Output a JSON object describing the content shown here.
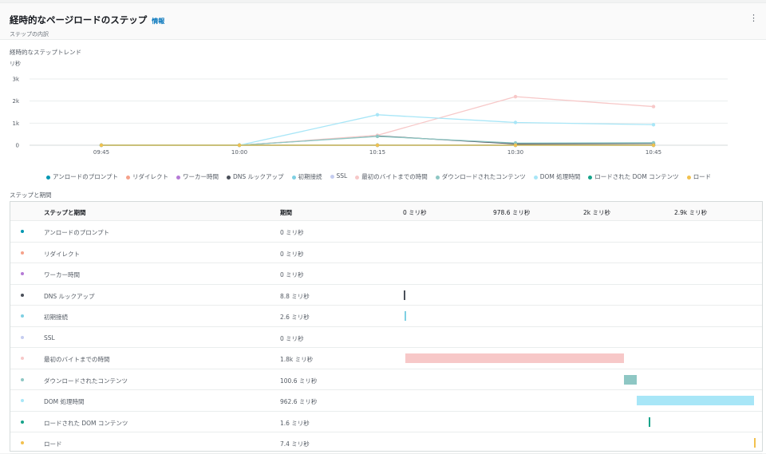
{
  "header": {
    "title": "経時的なページロードのステップ",
    "info": "情報",
    "subtitle": "ステップの内訳",
    "menu": "⋮"
  },
  "chart_section": {
    "title": "経時的なステップトレンド"
  },
  "chart_data": {
    "type": "line",
    "ylabel": "リ秒",
    "ylim": [
      0,
      3000
    ],
    "grid": true,
    "legend": "bottom",
    "yticks": [
      "0",
      "1k",
      "2k",
      "3k"
    ],
    "ytick_values": [
      0,
      1000,
      2000,
      3000
    ],
    "x": [
      "09:45",
      "10:00",
      "10:15",
      "10:30",
      "10:45"
    ],
    "series": [
      {
        "name": "アンロードのプロンプト",
        "color": "#0097b2",
        "values": [
          0,
          0,
          0,
          0,
          0
        ]
      },
      {
        "name": "リダイレクト",
        "color": "#f5a18a",
        "values": [
          0,
          0,
          0,
          0,
          0
        ]
      },
      {
        "name": "ワーカー時間",
        "color": "#b57ad6",
        "values": [
          0,
          0,
          0,
          0,
          0
        ]
      },
      {
        "name": "DNS ルックアップ",
        "color": "#4a4f59",
        "values": [
          0,
          0,
          420,
          60,
          80
        ]
      },
      {
        "name": "初期接続",
        "color": "#7fd0e3",
        "values": [
          0,
          0,
          0,
          0,
          0
        ]
      },
      {
        "name": "SSL",
        "color": "#c5cdf0",
        "values": [
          0,
          0,
          0,
          0,
          0
        ]
      },
      {
        "name": "最初のバイトまでの時間",
        "color": "#f7c8c8",
        "values": [
          0,
          0,
          450,
          2200,
          1750
        ]
      },
      {
        "name": "ダウンロードされたコンテンツ",
        "color": "#8ec7c4",
        "values": [
          0,
          0,
          400,
          100,
          110
        ]
      },
      {
        "name": "DOM 処理時間",
        "color": "#a8e6f7",
        "values": [
          0,
          0,
          1380,
          1030,
          930
        ]
      },
      {
        "name": "ロードされた DOM コンテンツ",
        "color": "#16a38a",
        "values": [
          0,
          0,
          0,
          0,
          0
        ]
      },
      {
        "name": "ロード",
        "color": "#f2c14e",
        "values": [
          0,
          0,
          0,
          0,
          0
        ]
      }
    ]
  },
  "table": {
    "section_title": "ステップと期間",
    "headers": {
      "step": "ステップと期間",
      "duration": "期間",
      "scale": [
        "0 ミリ秒",
        "978.6 ミリ秒",
        "2k ミリ秒",
        "2.9k ミリ秒"
      ]
    },
    "scale_max_ms": 2883,
    "rows": [
      {
        "name": "アンロードのプロンプト",
        "duration": "0 ミリ秒",
        "color": "#0097b2",
        "start_ms": 0,
        "ms": 0
      },
      {
        "name": "リダイレクト",
        "duration": "0 ミリ秒",
        "color": "#f5a18a",
        "start_ms": 0,
        "ms": 0
      },
      {
        "name": "ワーカー時間",
        "duration": "0 ミリ秒",
        "color": "#b57ad6",
        "start_ms": 0,
        "ms": 0
      },
      {
        "name": "DNS ルックアップ",
        "duration": "8.8 ミリ秒",
        "color": "#4a4f59",
        "start_ms": 0,
        "ms": 8.8
      },
      {
        "name": "初期接続",
        "duration": "2.6 ミリ秒",
        "color": "#7fd0e3",
        "start_ms": 8.8,
        "ms": 2.6
      },
      {
        "name": "SSL",
        "duration": "0 ミリ秒",
        "color": "#c5cdf0",
        "start_ms": 11.4,
        "ms": 0
      },
      {
        "name": "最初のバイトまでの時間",
        "duration": "1.8k ミリ秒",
        "color": "#f7c8c8",
        "start_ms": 11.4,
        "ms": 1800
      },
      {
        "name": "ダウンロードされたコンテンツ",
        "duration": "100.6 ミリ秒",
        "color": "#8ec7c4",
        "start_ms": 1811.4,
        "ms": 100.6
      },
      {
        "name": "DOM 処理時間",
        "duration": "962.6 ミリ秒",
        "color": "#a8e6f7",
        "start_ms": 1912,
        "ms": 962.6
      },
      {
        "name": "ロードされた DOM コンテンツ",
        "duration": "1.6 ミリ秒",
        "color": "#16a38a",
        "start_ms": 2010,
        "ms": 1.6
      },
      {
        "name": "ロード",
        "duration": "7.4 ミリ秒",
        "color": "#f2c14e",
        "start_ms": 2875.6,
        "ms": 7.4
      }
    ]
  }
}
